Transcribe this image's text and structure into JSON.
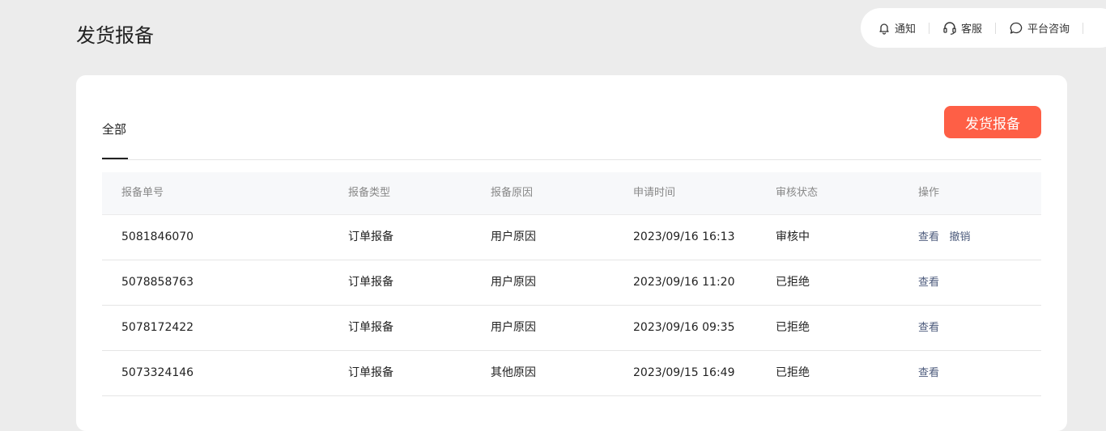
{
  "page": {
    "title": "发货报备"
  },
  "topbar": {
    "notify_label": "通知",
    "service_label": "客服",
    "consult_label": "平台咨询",
    "notify_icon": "bell-icon",
    "service_icon": "headset-icon",
    "consult_icon": "chat-bubble-icon"
  },
  "tabs": [
    {
      "label": "全部",
      "active": true
    }
  ],
  "primary_button": {
    "label": "发货报备",
    "color": "#fe5f46"
  },
  "table": {
    "headers": [
      "报备单号",
      "报备类型",
      "报备原因",
      "申请时间",
      "审核状态",
      "操作"
    ],
    "rows": [
      {
        "id": "5081846070",
        "type": "订单报备",
        "reason": "用户原因",
        "time": "2023/09/16 16:13",
        "status": "审核中",
        "actions": [
          "查看",
          "撤销"
        ]
      },
      {
        "id": "5078858763",
        "type": "订单报备",
        "reason": "用户原因",
        "time": "2023/09/16 11:20",
        "status": "已拒绝",
        "actions": [
          "查看"
        ]
      },
      {
        "id": "5078172422",
        "type": "订单报备",
        "reason": "用户原因",
        "time": "2023/09/16 09:35",
        "status": "已拒绝",
        "actions": [
          "查看"
        ]
      },
      {
        "id": "5073324146",
        "type": "订单报备",
        "reason": "其他原因",
        "time": "2023/09/15 16:49",
        "status": "已拒绝",
        "actions": [
          "查看"
        ]
      }
    ]
  },
  "colors": {
    "accent": "#fe5f46",
    "link": "#4d5b7c",
    "background": "#ececec"
  }
}
